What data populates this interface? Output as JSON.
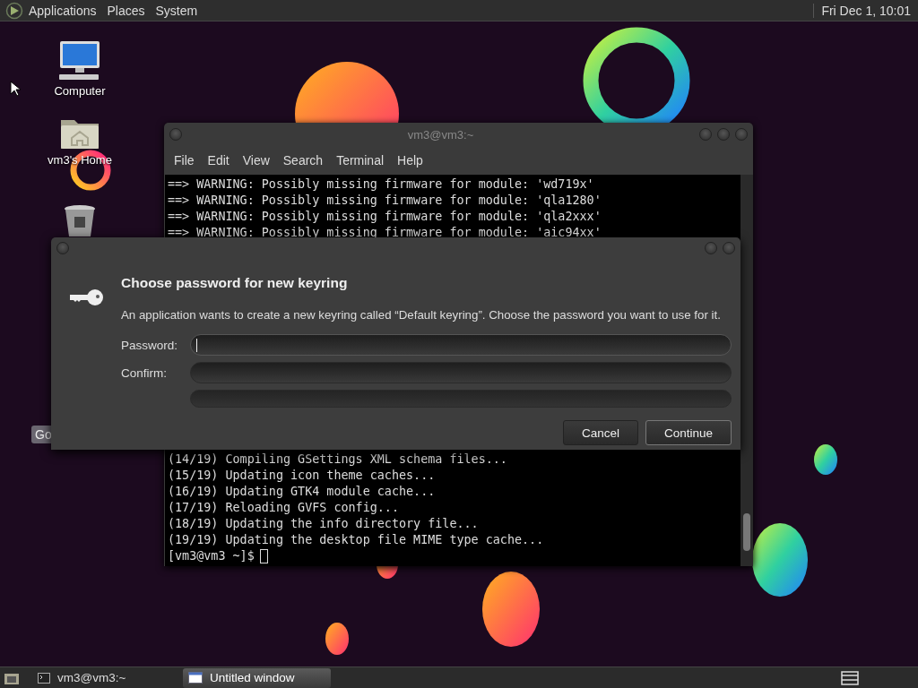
{
  "top_panel": {
    "menus": [
      {
        "label": "Applications"
      },
      {
        "label": "Places"
      },
      {
        "label": "System"
      }
    ],
    "clock": "Fri Dec 1, 10:01"
  },
  "desktop_icons": [
    {
      "kind": "computer",
      "label": "Computer"
    },
    {
      "kind": "home",
      "label": "vm3's Home"
    },
    {
      "kind": "trash"
    }
  ],
  "tooltip": "Go",
  "terminal": {
    "title": "vm3@vm3:~",
    "menus": [
      "File",
      "Edit",
      "View",
      "Search",
      "Terminal",
      "Help"
    ],
    "lines_top": [
      "==> WARNING: Possibly missing firmware for module: 'wd719x'",
      "==> WARNING: Possibly missing firmware for module: 'qla1280'",
      "==> WARNING: Possibly missing firmware for module: 'qla2xxx'",
      "==> WARNING: Possibly missing firmware for module: 'aic94xx'"
    ],
    "lines_bottom": [
      "(14/19) Compiling GSettings XML schema files...",
      "(15/19) Updating icon theme caches...",
      "(16/19) Updating GTK4 module cache...",
      "(17/19) Reloading GVFS config...",
      "(18/19) Updating the info directory file...",
      "(19/19) Updating the desktop file MIME type cache..."
    ],
    "prompt": "[vm3@vm3 ~]$"
  },
  "dialog": {
    "title": "Choose password for new keyring",
    "message": "An application wants to create a new keyring called “Default keyring”. Choose the password you want to use for it.",
    "fields": [
      {
        "label": "Password:",
        "focused": true
      },
      {
        "label": "Confirm:",
        "focused": false
      }
    ],
    "strength_meter": {
      "level": 0
    },
    "buttons": [
      "Cancel",
      "Continue"
    ]
  },
  "taskbar": {
    "tasks": [
      {
        "kind": "terminal",
        "label": "vm3@vm3:~",
        "selected": false
      },
      {
        "kind": "window",
        "label": "Untitled window",
        "selected": true
      }
    ]
  }
}
